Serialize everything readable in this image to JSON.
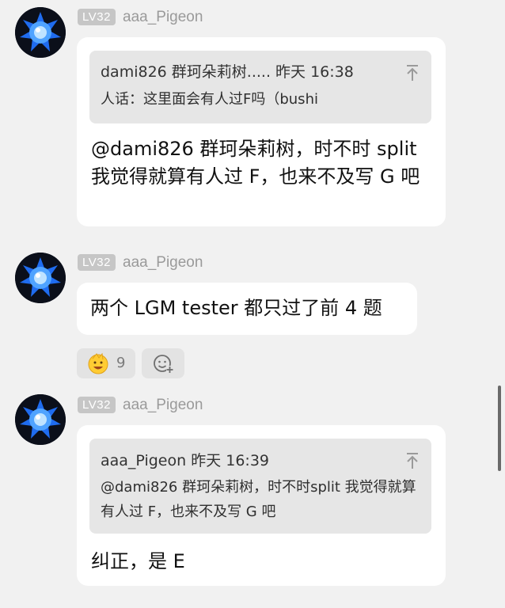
{
  "messages": [
    {
      "level": "LV32",
      "username": "aaa_Pigeon",
      "quote": {
        "header": "dami826 群珂朵莉树..... 昨天 16:38",
        "text": "人话：这里面会有人过F吗（bushi"
      },
      "text": "@dami826 群珂朵莉树，时不时 split 我觉得就算有人过 F，也来不及写 G 吧"
    },
    {
      "level": "LV32",
      "username": "aaa_Pigeon",
      "text": "两个 LGM tester 都只过了前 4 题",
      "reactions": [
        {
          "icon": "grinning-emoji-icon",
          "count": "9"
        },
        {
          "icon": "add-reaction-icon"
        }
      ]
    },
    {
      "level": "LV32",
      "username": "aaa_Pigeon",
      "quote": {
        "header": "aaa_Pigeon 昨天 16:39",
        "text": "@dami826 群珂朵莉树，时不时split 我觉得就算有人过 F，也来不及写 G 吧"
      },
      "text": "纠正，是 E"
    }
  ],
  "colors": {
    "background": "#f1f1f1",
    "bubble": "#ffffff",
    "quote": "#e6e6e6",
    "level_badge": "#c6c6c6",
    "username": "#9a9a9a",
    "avatar_blue": "#2f7dff"
  }
}
